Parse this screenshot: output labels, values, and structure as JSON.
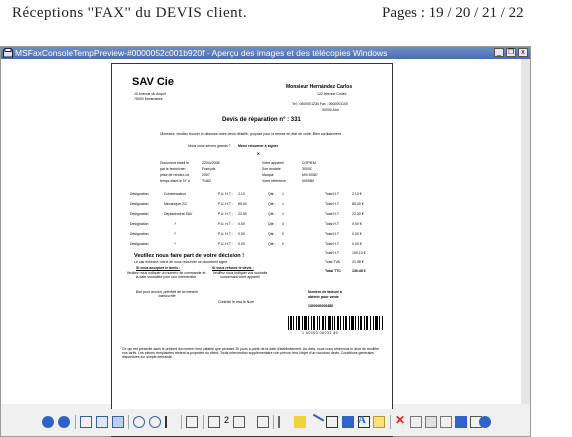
{
  "header": {
    "title": "Réceptions ''FAX'' du DEVIS client.",
    "pages": "Pages : 19 / 20 / 21 / 22"
  },
  "window": {
    "title": "MSFaxConsoleTempPreview-#0000052c001b920f - Aperçu des images et des télécopies Windows",
    "minimize": "_",
    "restore": "❐",
    "close": "x"
  },
  "document": {
    "company": "SAV    Cie",
    "company_addr": [
      "10 Avenue du Acquit",
      "75000 Montmartre"
    ],
    "client_name": "Monsieur Hernández Carlos",
    "client_addr": "122 Avenue Codex",
    "client_tel": "Tel : 0600001234    Fax : 0600001100",
    "client_city": "40000 Ahô",
    "devis_title": "Devis de réparation n° : 331",
    "intro": "Monsieur, veuillez trouver ci-dessous notre devis détaillé, proposé pour la remise en état de votre. Bien cordialement.",
    "decision_label": "Nous vous serons grands ?",
    "decision_value": "Merci retourner à signer",
    "decision_mark": "X",
    "info_left": [
      {
        "label": "Document établi le",
        "value": "22/04/2008"
      },
      {
        "label": "par le technicien",
        "value": "François"
      },
      {
        "label": "prise de rendez-vd",
        "value": "2007"
      },
      {
        "label": "temps étant le N° d",
        "value": "T/462"
      }
    ],
    "info_right": [
      {
        "label": "Votre appareil",
        "value": "COPIEM"
      },
      {
        "label": "Son modèle",
        "value": "3000C"
      },
      {
        "label": "Marqué",
        "value": "MV/10087"
      },
      {
        "label": "Votre référence",
        "value": "0000B0"
      }
    ],
    "lines": [
      {
        "designation": "Désignation",
        "name": "Condensateur",
        "pu": "P.U. H.T :",
        "price": "2.10",
        "qty_label": "Qté :",
        "qty": "1",
        "total_label": "Total H.T",
        "total": "2.10 €"
      },
      {
        "designation": "Désignation",
        "name": "Mécanique 2/2",
        "pu": "P.U. H.T :",
        "price": "85.00",
        "qty_label": "Qté :",
        "qty": "1",
        "total_label": "Total H.T",
        "total": "85.00 €"
      },
      {
        "designation": "Désignation",
        "name": "Déplacement SAV",
        "pu": "P.U. H.T :",
        "price": "22.00",
        "qty_label": "Qté :",
        "qty": "1",
        "total_label": "Total H.T",
        "total": "22.00 €"
      },
      {
        "designation": "Désignation",
        "name": "?",
        "pu": "P.U. H.T :",
        "price": "0.00",
        "qty_label": "Qté :",
        "qty": "0",
        "total_label": "Total H.T",
        "total": "0.00 €"
      },
      {
        "designation": "Désignation",
        "name": "?",
        "pu": "P.U. H.T :",
        "price": "0.00",
        "qty_label": "Qté :",
        "qty": "0",
        "total_label": "Total H.T",
        "total": "0.00 €"
      },
      {
        "designation": "Désignation",
        "name": "?",
        "pu": "P.U. H.T :",
        "price": "0.00",
        "qty_label": "Qté :",
        "qty": "0",
        "total_label": "Total H.T",
        "total": "0.00 €"
      }
    ],
    "total_ht": {
      "label": "Total H.T",
      "value": "109.10 €"
    },
    "tva": {
      "label": "Total TVA",
      "value": "21.38 €"
    },
    "total_ttc": {
      "label": "Total TTC",
      "value": "130.48 €"
    },
    "decision_heading": "Veuillez nous faire part de votre décision !",
    "decision_sub": "Le cas échéant, merci de nous retourner ce document signé",
    "accept_label": "Si vous acceptez le devis :",
    "refuse_label": "Si vous refusez le devis :",
    "accept_text": "Veuillez nous indiquer un numéro de commande et la date souhaitée pour une intervention",
    "refuse_text": "Veuillez nous indiquer vos souhaits concernant votre appareil",
    "order_label": "Numéro de facture à",
    "order_sub": "obtenir pour vente",
    "sign_left": "Bon pour accord, précédé de la mention manuscrite",
    "sign_center": "Contrôlé le visa le Nom",
    "order_number": "1000000003380",
    "barcode_number": "1 00000 00033 80",
    "footer": "Ce qui est présenté dans le présent document n'est valable que pendant 30 jours à partir de la date d'établissement. Au-delà, nous nous réservons le droit de modifier nos tarifs. Les pièces remplacées restent la propriété du client. Toute intervention supplémentaire non prévue fera l'objet d'un nouveau devis. Conditions générales disponibles sur simple demande."
  },
  "toolbar": {
    "icons": [
      "prev-image-icon",
      "next-image-icon",
      "best-fit-icon",
      "actual-size-icon",
      "slideshow-icon",
      "zoom-in-icon",
      "zoom-out-icon",
      "select-icon",
      "rotate-icon",
      "page-select-icon",
      "prev-page-icon",
      "next-page-icon",
      "pen-icon",
      "highlighter-icon",
      "line-icon",
      "arrow-icon",
      "rectangle-icon",
      "filled-rectangle-icon",
      "text-icon",
      "note-icon",
      "delete-icon",
      "copy-icon",
      "print-icon",
      "save-icon",
      "save-as-icon",
      "help-icon"
    ],
    "page_number": "2"
  }
}
